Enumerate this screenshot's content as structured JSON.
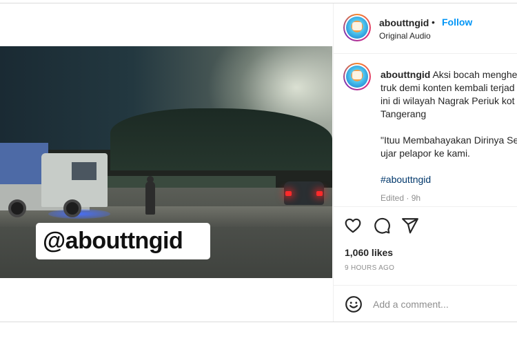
{
  "post": {
    "username": "abouttngid",
    "dot": "•",
    "follow_label": "Follow",
    "audio_label": "Original Audio"
  },
  "media": {
    "watermark": "@abouttngid",
    "mute_icon": "muted-speaker-icon"
  },
  "caption": {
    "username": "abouttngid",
    "line1": "Aksi bocah menghe",
    "line2": "truk demi konten kembali terjad",
    "line3": "ini di wilayah Nagrak Periuk kot",
    "line4": "Tangerang",
    "line5": "\"Ituu Membahayakan Dirinya Se",
    "line6": "ujar pelapor ke kami.",
    "hashtag": "#abouttngid",
    "edited": "Edited · 9h"
  },
  "actions": {
    "like_icon": "heart-icon",
    "comment_icon": "comment-icon",
    "share_icon": "share-icon"
  },
  "stats": {
    "likes": "1,060 likes",
    "time_ago": "9 HOURS AGO"
  },
  "comment": {
    "placeholder": "Add a comment...",
    "emoji_icon": "emoji-icon"
  },
  "colors": {
    "follow": "#0095f6",
    "hashtag": "#00376b",
    "muted_text": "#8e8e8e",
    "text": "#262626"
  }
}
